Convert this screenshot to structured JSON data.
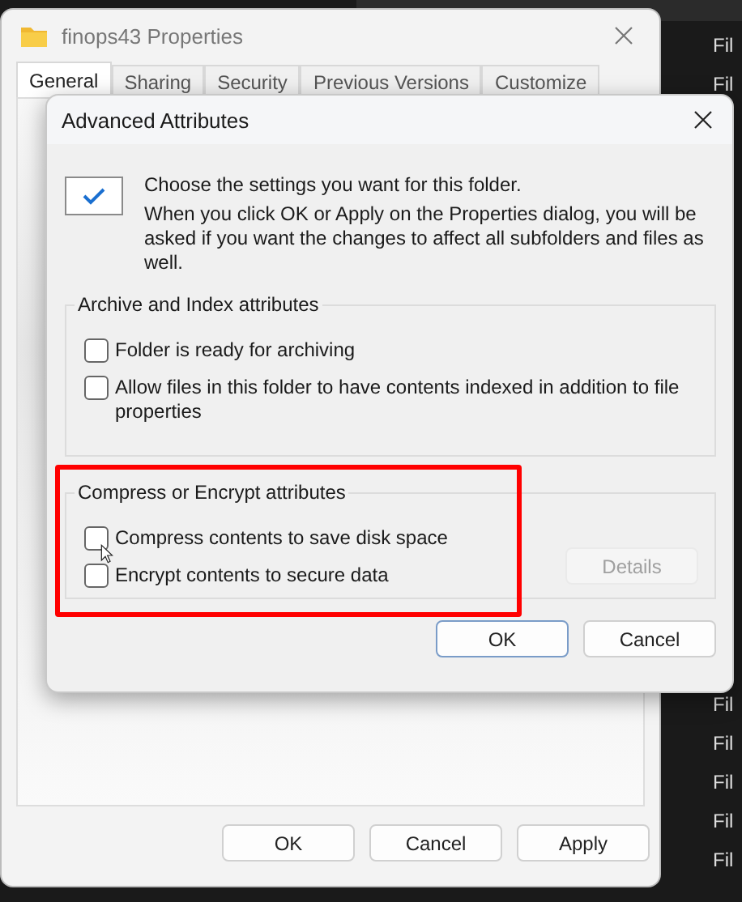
{
  "background": {
    "top_labels": [
      "Fil",
      "Fil"
    ],
    "bottom_labels": [
      "Fil",
      "Fil",
      "Fil",
      "Fil",
      "Fil"
    ]
  },
  "properties_window": {
    "title": "finops43 Properties",
    "tabs": [
      {
        "label": "General",
        "selected": true
      },
      {
        "label": "Sharing",
        "selected": false
      },
      {
        "label": "Security",
        "selected": false
      },
      {
        "label": "Previous Versions",
        "selected": false
      },
      {
        "label": "Customize",
        "selected": false
      }
    ],
    "buttons": [
      "OK",
      "Cancel",
      "Apply"
    ]
  },
  "advanced_dialog": {
    "title": "Advanced Attributes",
    "intro": "Choose the settings you want for this folder.",
    "note": "When you click OK or Apply on the Properties dialog, you will be asked if you want the changes to affect all subfolders and files as well.",
    "groups": [
      {
        "title": "Archive and Index attributes",
        "options": [
          {
            "label": "Folder is ready for archiving",
            "checked": false
          },
          {
            "label": "Allow files in this folder to have contents indexed in addition to file properties",
            "checked": false
          }
        ]
      },
      {
        "title": "Compress or Encrypt attributes",
        "highlighted": true,
        "options": [
          {
            "label": "Compress contents to save disk space",
            "checked": false
          },
          {
            "label": "Encrypt contents to secure data",
            "checked": false
          }
        ],
        "button": {
          "label": "Details",
          "disabled": true
        }
      }
    ],
    "buttons": [
      {
        "label": "OK",
        "default": true
      },
      {
        "label": "Cancel",
        "default": false
      }
    ]
  }
}
